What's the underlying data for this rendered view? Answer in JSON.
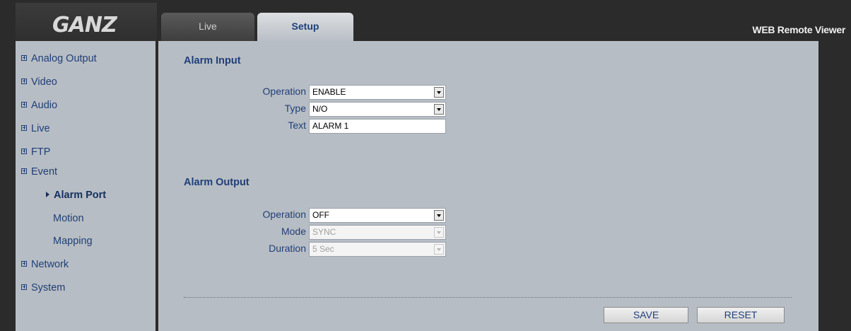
{
  "brand": {
    "logo": "GANZ"
  },
  "tabs": [
    {
      "label": "Live"
    },
    {
      "label": "Setup"
    }
  ],
  "app_title": "WEB Remote Viewer",
  "sidebar": {
    "items": [
      {
        "label": "Analog Output"
      },
      {
        "label": "Video"
      },
      {
        "label": "Audio"
      },
      {
        "label": "Live"
      },
      {
        "label": "FTP"
      },
      {
        "label": "Event"
      },
      {
        "label": "Alarm Port"
      },
      {
        "label": "Motion"
      },
      {
        "label": "Mapping"
      },
      {
        "label": "Network"
      },
      {
        "label": "System"
      }
    ]
  },
  "alarm_input": {
    "title": "Alarm Input",
    "operation_label": "Operation",
    "operation_value": "ENABLE",
    "type_label": "Type",
    "type_value": "N/O",
    "text_label": "Text",
    "text_value": "ALARM 1"
  },
  "alarm_output": {
    "title": "Alarm Output",
    "operation_label": "Operation",
    "operation_value": "OFF",
    "mode_label": "Mode",
    "mode_value": "SYNC",
    "duration_label": "Duration",
    "duration_value": "5 Sec"
  },
  "buttons": {
    "save": "SAVE",
    "reset": "RESET"
  }
}
